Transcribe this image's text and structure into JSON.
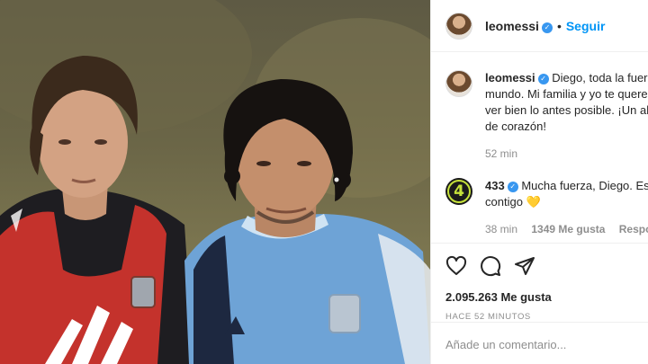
{
  "header": {
    "username": "leomessi",
    "follow_label": "Seguir"
  },
  "caption": {
    "username": "leomessi",
    "text": "Diego, toda la fuerza del mundo. Mi familia y yo te queremos ver bien lo antes posible. ¡Un abrazo de corazón!",
    "time": "52 min"
  },
  "comment": {
    "avatar_text": "4",
    "username": "433",
    "text": "Mucha fuerza, Diego. Estamos contigo",
    "emoji": "💛",
    "time": "38 min",
    "likes": "1349 Me gusta",
    "reply": "Responder"
  },
  "post": {
    "likes": "2.095.263 Me gusta",
    "timestamp": "HACE 52 MINUTOS",
    "add_comment_placeholder": "Añade un comentario..."
  },
  "icons": [
    "heart-icon",
    "comment-icon",
    "share-icon",
    "verified-icon"
  ],
  "colors": {
    "accent": "#0095f6",
    "verified": "#3897f0",
    "muted": "#8e8e8e"
  }
}
